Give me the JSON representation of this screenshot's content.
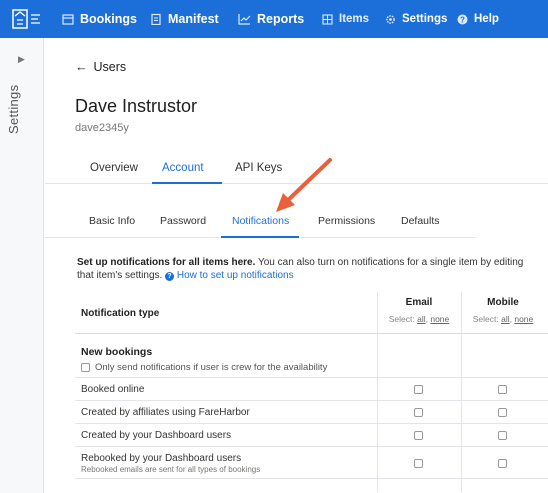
{
  "nav": {
    "items": [
      {
        "label": "Bookings",
        "icon": "calendar-icon"
      },
      {
        "label": "Manifest",
        "icon": "clipboard-icon"
      },
      {
        "label": "Reports",
        "icon": "chart-icon"
      },
      {
        "label": "Items",
        "icon": "grid-icon"
      },
      {
        "label": "Settings",
        "icon": "gear-icon"
      },
      {
        "label": "Help",
        "icon": "help-icon"
      }
    ],
    "brand_color": "#1c6fd8"
  },
  "rail": {
    "label": "Settings"
  },
  "back_label": "Users",
  "user": {
    "name": "Dave Instrustor",
    "handle": "dave2345y"
  },
  "tabs": [
    "Overview",
    "Account",
    "API Keys"
  ],
  "active_tab": "Account",
  "subtabs": [
    "Basic Info",
    "Password",
    "Notifications",
    "Permissions",
    "Defaults"
  ],
  "active_subtab": "Notifications",
  "intro": {
    "bold": "Set up notifications for all items here.",
    "text": " You can also turn on notifications for a single item by editing that item's settings.",
    "help_link": "How to set up notifications"
  },
  "table": {
    "type_header": "Notification type",
    "columns": [
      {
        "label": "Email",
        "select_prefix": "Select:",
        "all": "all",
        "none": "none"
      },
      {
        "label": "Mobile",
        "select_prefix": "Select:",
        "all": "all",
        "none": "none"
      }
    ],
    "group": {
      "title": "New bookings",
      "option": "Only send notifications if user is crew for the availability"
    },
    "rows": [
      {
        "label": "Booked online",
        "sub": ""
      },
      {
        "label": "Created by affiliates using FareHarbor",
        "sub": ""
      },
      {
        "label": "Created by your Dashboard users",
        "sub": ""
      },
      {
        "label": "Rebooked by your Dashboard users",
        "sub": "Rebooked emails are sent for all types of bookings"
      }
    ]
  },
  "annotation_color": "#e8613a"
}
